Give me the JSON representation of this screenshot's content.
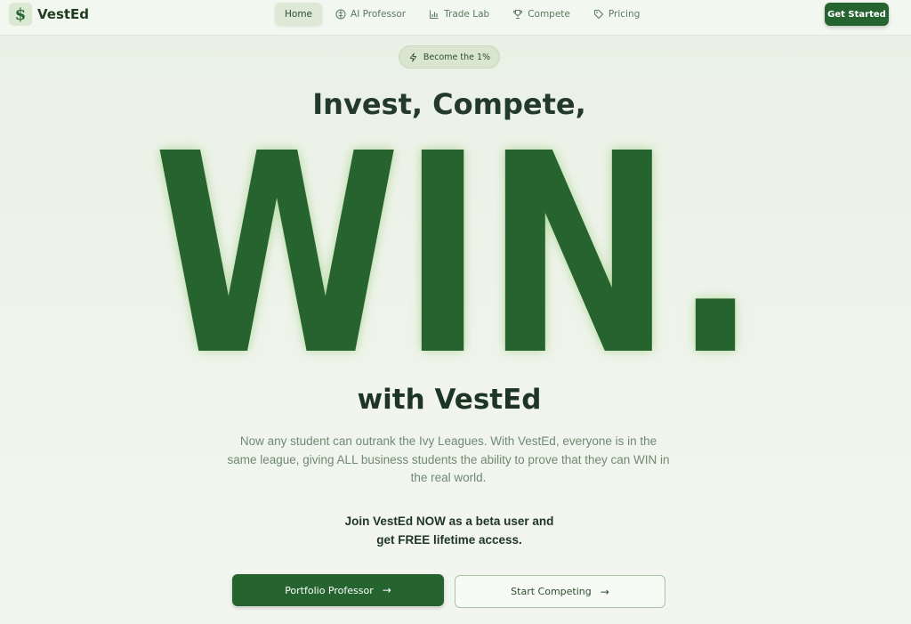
{
  "brand": {
    "logo_glyph": "$",
    "name": "VestEd"
  },
  "nav": {
    "items": [
      {
        "label": "Home",
        "icon": "none",
        "active": true
      },
      {
        "label": "AI Professor",
        "icon": "brain-icon",
        "active": false
      },
      {
        "label": "Trade Lab",
        "icon": "bar-chart-icon",
        "active": false
      },
      {
        "label": "Compete",
        "icon": "trophy-icon",
        "active": false
      },
      {
        "label": "Pricing",
        "icon": "tag-icon",
        "active": false
      }
    ],
    "cta": "Get Started"
  },
  "hero": {
    "badge": "Become the 1%",
    "headline": "Invest, Compete,",
    "big_word": "WIN.",
    "subhead": "with VestEd",
    "description": "Now any student can outrank the Ivy Leagues. With VestEd, everyone is in the same league, giving ALL business students the ability to prove that they can WIN in the real world.",
    "join_line1": "Join VestEd NOW as a beta user and",
    "join_line2": "get FREE lifetime access.",
    "primary_button": "Portfolio Professor",
    "secondary_button": "Start Competing",
    "arrow": "→"
  },
  "colors": {
    "accent": "#25642f",
    "background": "#eef3ea",
    "text_dark": "#1f3524",
    "text_muted": "#6f8a71"
  }
}
